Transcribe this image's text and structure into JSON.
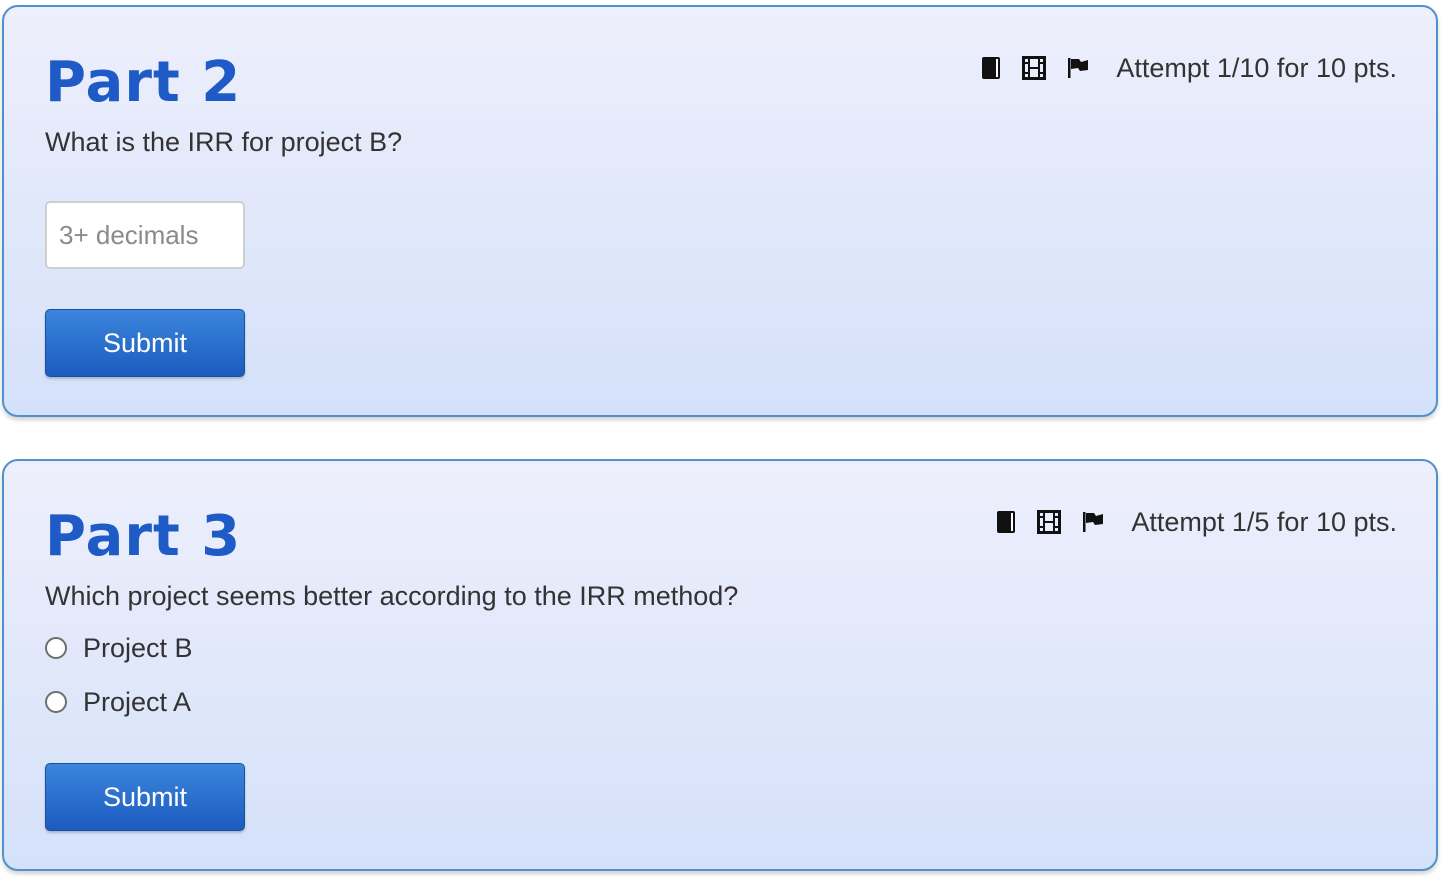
{
  "parts": [
    {
      "title": "Part 2",
      "question": "What is the IRR for project B?",
      "attempt": "Attempt 1/10 for 10 pts.",
      "icons": [
        "book-icon",
        "film-icon",
        "flag-icon"
      ],
      "input": {
        "value": "",
        "placeholder": "3+ decimals"
      },
      "submit_label": "Submit"
    },
    {
      "title": "Part 3",
      "question": "Which project seems better according to the IRR method?",
      "attempt": "Attempt 1/5 for 10 pts.",
      "icons": [
        "book-icon",
        "film-icon",
        "flag-icon"
      ],
      "options": [
        {
          "label": "Project B",
          "selected": false
        },
        {
          "label": "Project A",
          "selected": false
        }
      ],
      "submit_label": "Submit"
    }
  ],
  "colors": {
    "title": "#1f5bc6",
    "card_border": "#4f91cc",
    "button": "#1c5bbf"
  }
}
